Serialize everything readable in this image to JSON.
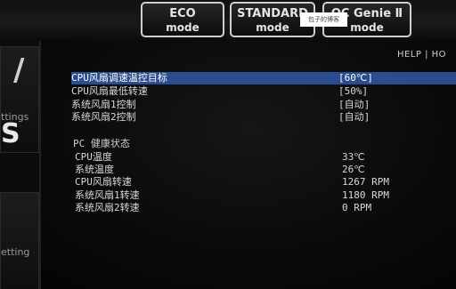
{
  "modes": {
    "eco": {
      "line1": "ECO",
      "line2": "mode"
    },
    "standard": {
      "line1": "STANDARD",
      "line2": "mode"
    },
    "oc": {
      "line1": "OC Genie Ⅱ",
      "line2": "mode"
    }
  },
  "watermark": "包子的博客",
  "help": "HELP | HO",
  "left_panel": {
    "settings": "ttings",
    "big": "S",
    "setting": "etting",
    "slash": "/"
  },
  "fan_settings": [
    {
      "label": "CPU风扇调速温控目标",
      "value": "[60℃]"
    },
    {
      "label": "CPU风扇最低转速",
      "value": "[50%]"
    },
    {
      "label": "系统风扇1控制",
      "value": "[自动]"
    },
    {
      "label": "系统风扇2控制",
      "value": "[自动]"
    }
  ],
  "health": {
    "title": "PC 健康状态",
    "items": [
      {
        "label": "CPU温度",
        "value": "33℃"
      },
      {
        "label": "系统温度",
        "value": "26℃"
      },
      {
        "label": "CPU风扇转速",
        "value": "1267 RPM"
      },
      {
        "label": "系统风扇1转速",
        "value": "1180 RPM"
      },
      {
        "label": "系统风扇2转速",
        "value": "0 RPM"
      }
    ]
  },
  "colors": {
    "selected_row": "#2a4d8f",
    "background": "#050505",
    "text": "#d8d8d8"
  }
}
